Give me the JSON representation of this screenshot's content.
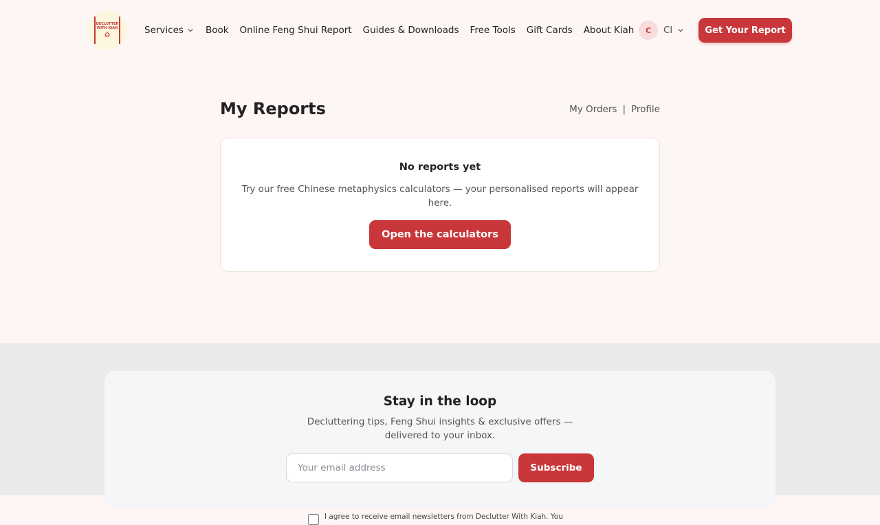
{
  "brand": {
    "logo_text": "DECLUTTER WITH KIAH",
    "accent_color": "#c9373a"
  },
  "nav": {
    "items": [
      {
        "label": "Services",
        "has_dropdown": true
      },
      {
        "label": "Book"
      },
      {
        "label": "Online Feng Shui Report"
      },
      {
        "label": "Guides & Downloads"
      },
      {
        "label": "Free Tools"
      },
      {
        "label": "Gift Cards"
      },
      {
        "label": "About Kiah"
      }
    ],
    "user": {
      "avatar_initial": "C",
      "name": "Cl"
    },
    "cta_label": "Get Your Report"
  },
  "main": {
    "title": "My Reports",
    "links": {
      "orders": "My Orders",
      "separator": "|",
      "profile": "Profile"
    },
    "empty_state": {
      "title": "No reports yet",
      "text": "Try our free Chinese metaphysics calculators — your personalised reports will appear here.",
      "button_label": "Open the calculators"
    }
  },
  "footer": {
    "newsletter": {
      "title": "Stay in the loop",
      "subtitle": "Decluttering tips, Feng Shui insights & exclusive offers — delivered to your inbox.",
      "email_placeholder": "Your email address",
      "email_value": "",
      "subscribe_label": "Subscribe",
      "consent_text": "I agree to receive email newsletters from Declutter With Kiah. You",
      "consent_checked": false
    }
  }
}
